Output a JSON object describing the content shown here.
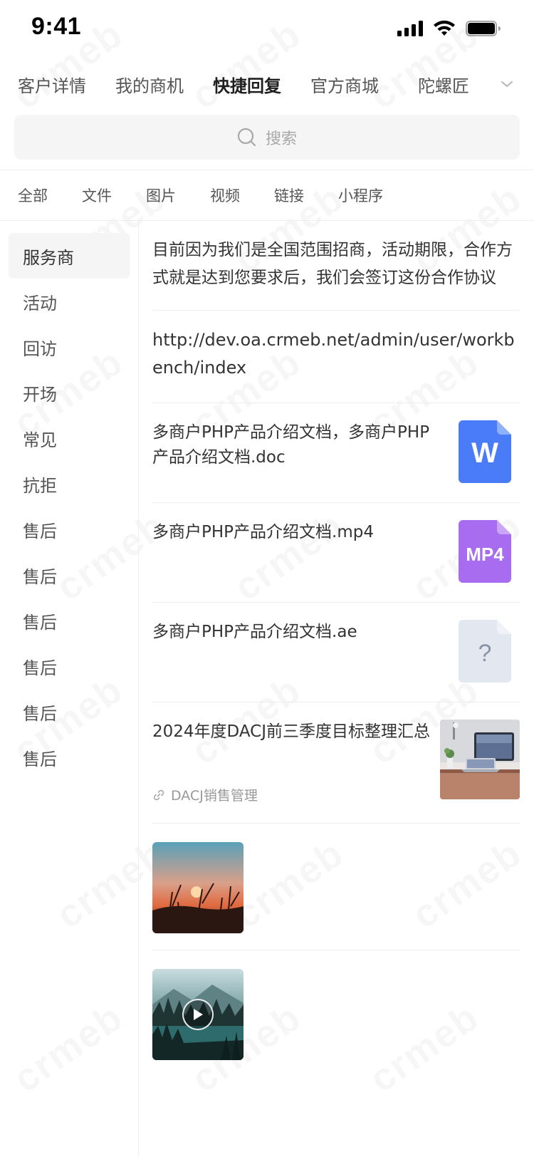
{
  "status_bar": {
    "time": "9:41",
    "icons": [
      "cellular-signal-icon",
      "wifi-icon",
      "battery-icon"
    ]
  },
  "top_tabs": {
    "items": [
      {
        "label": "客户详情",
        "active": false
      },
      {
        "label": "我的商机",
        "active": false
      },
      {
        "label": "快捷回复",
        "active": true
      },
      {
        "label": "官方商城",
        "active": false
      },
      {
        "label": "陀螺匠",
        "active": false
      }
    ],
    "more_icon": "chevron-down-icon"
  },
  "search": {
    "placeholder": "搜索"
  },
  "type_tabs": {
    "items": [
      "全部",
      "文件",
      "图片",
      "视频",
      "链接",
      "小程序"
    ]
  },
  "sidebar": {
    "items": [
      {
        "label": "服务商",
        "active": true
      },
      {
        "label": "活动",
        "active": false
      },
      {
        "label": "回访",
        "active": false
      },
      {
        "label": "开场",
        "active": false
      },
      {
        "label": "常见",
        "active": false
      },
      {
        "label": "抗拒",
        "active": false
      },
      {
        "label": "售后",
        "active": false
      },
      {
        "label": "售后",
        "active": false
      },
      {
        "label": "售后",
        "active": false
      },
      {
        "label": "售后",
        "active": false
      },
      {
        "label": "售后",
        "active": false
      },
      {
        "label": "售后",
        "active": false
      }
    ]
  },
  "content": {
    "text_reply": "目前因为我们是全国范围招商，活动期限，合作方式就是达到您要求后，我们会签订这份合作协议",
    "link_reply": "http://dev.oa.crmeb.net/admin/user/workbench/index",
    "files": [
      {
        "title": "多商户PHP产品介绍文档，多商户PHP产品介绍文档.doc",
        "icon_label": "W",
        "icon_color": "#4a7cf7",
        "icon": "word-file-icon"
      },
      {
        "title": "多商户PHP产品介绍文档.mp4",
        "icon_label": "MP4",
        "icon_color": "#a86cf0",
        "icon": "video-file-icon"
      },
      {
        "title": "多商户PHP产品介绍文档.ae",
        "icon_label": "?",
        "icon_color": "#e3e7ef",
        "icon": "unknown-file-icon"
      }
    ],
    "article": {
      "title": "2024年度DACJ前三季度目标整理汇总",
      "source": "DACJ销售管理",
      "source_icon": "link-icon"
    },
    "media": [
      {
        "kind": "image",
        "description_icon": "image-thumbnail"
      },
      {
        "kind": "video",
        "description_icon": "video-thumbnail"
      }
    ]
  },
  "watermark": "crmeb"
}
